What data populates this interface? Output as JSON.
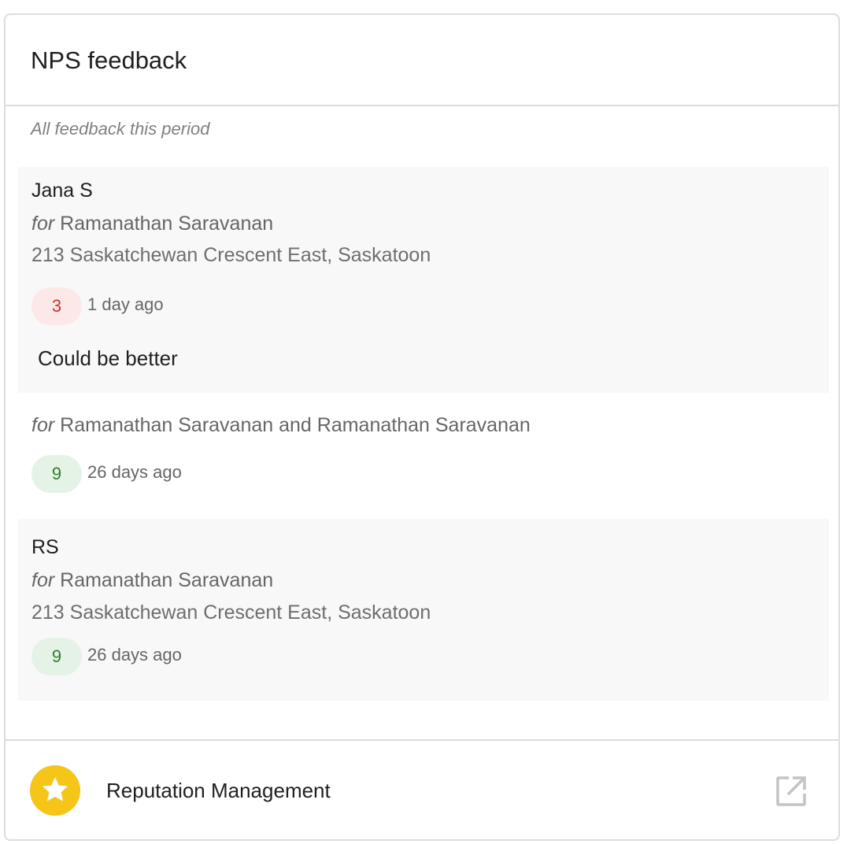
{
  "card": {
    "title": "NPS feedback",
    "subtitle": "All feedback this period"
  },
  "feedback": [
    {
      "name": "Jana S",
      "for_word": "for",
      "for_text": "Ramanathan Saravanan",
      "address": "213 Saskatchewan Crescent East, Saskatoon",
      "score": "3",
      "time": "1 day ago",
      "comment": "Could be better"
    },
    {
      "for_word": "for",
      "for_text": "Ramanathan Saravanan and Ramanathan Saravanan",
      "score": "9",
      "time": "26 days ago"
    },
    {
      "name": "RS",
      "for_word": "for",
      "for_text": "Ramanathan Saravanan",
      "address": "213 Saskatchewan Crescent East, Saskatoon",
      "score": "9",
      "time": "26 days ago"
    }
  ],
  "footer": {
    "app_name": "Reputation Management",
    "logo_icon": "star-icon",
    "link_icon": "external-link-icon"
  },
  "colors": {
    "score_low_bg": "#fde8e8",
    "score_low_text": "#d32f2f",
    "score_high_bg": "#e5f3e6",
    "score_high_text": "#2e7d32",
    "logo_bg": "#f5c518"
  }
}
